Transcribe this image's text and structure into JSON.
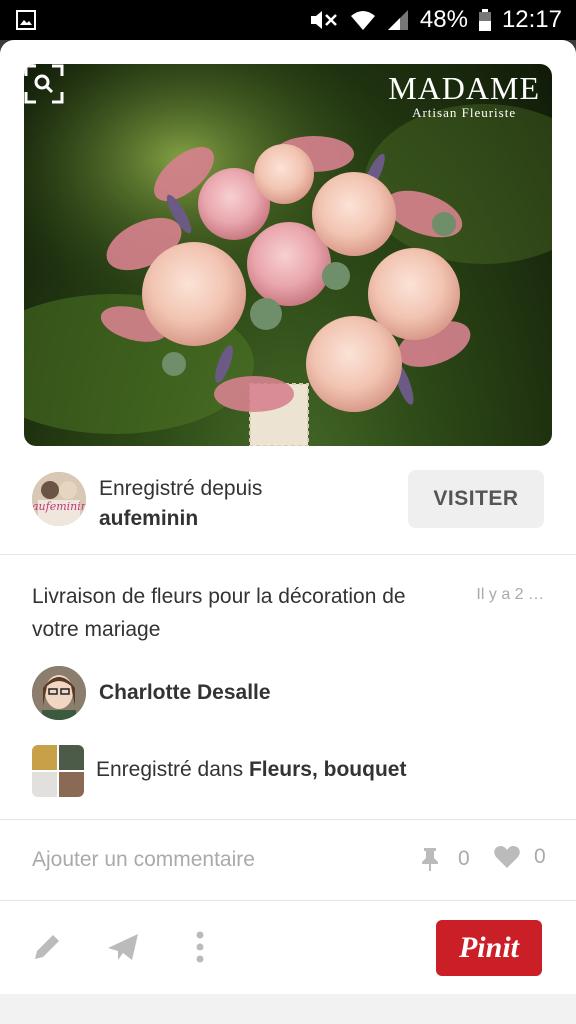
{
  "status_bar": {
    "battery": "48%",
    "time": "12:17",
    "icons": [
      "image-icon",
      "mute-icon",
      "wifi-icon",
      "signal-icon",
      "battery-icon"
    ]
  },
  "pin": {
    "image_brand": {
      "name": "MADAME",
      "subtitle": "Artisan Fleuriste"
    },
    "lens_icon": "visual-search-icon"
  },
  "source": {
    "label": "Enregistré depuis",
    "name": "aufeminin",
    "avatar_text": "aufeminin",
    "visit_label": "VISITER"
  },
  "description": "Livraison de fleurs pour la décoration de votre mariage",
  "time_ago": "Il y a 2 …",
  "pinner": {
    "name": "Charlotte Desalle"
  },
  "board": {
    "prefix": "Enregistré dans",
    "name": "Fleurs, bouquet"
  },
  "comment": {
    "placeholder": "Ajouter un commentaire"
  },
  "stats": {
    "repins": "0",
    "likes": "0"
  },
  "actions": {
    "pinit_label": "Pinit",
    "icons": [
      "edit-icon",
      "send-icon",
      "more-icon"
    ]
  },
  "colors": {
    "pinit": "#cb1f27",
    "visit_bg": "#efefef",
    "muted": "#aaaaaa"
  }
}
